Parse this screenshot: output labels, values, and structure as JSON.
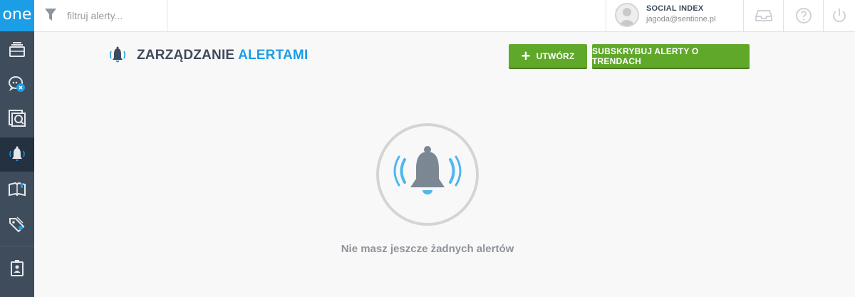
{
  "app": {
    "logo": "one"
  },
  "sidebar": {
    "items": [
      {
        "icon": "inbox-stack-icon"
      },
      {
        "icon": "chat-analysis-icon"
      },
      {
        "icon": "search-results-icon"
      },
      {
        "icon": "bell-alert-icon",
        "active": true
      },
      {
        "icon": "book-icon"
      },
      {
        "icon": "tags-icon"
      },
      {
        "icon": "id-badge-icon"
      }
    ]
  },
  "topbar": {
    "filter_placeholder": "filtruj alerty...",
    "user": {
      "name": "SOCIAL INDEX",
      "email": "jagoda@sentione.pl"
    },
    "buttons": [
      "inbox-icon",
      "help-icon",
      "power-icon"
    ]
  },
  "page": {
    "title_main": "ZARZĄDZANIE",
    "title_accent": "ALERTAMI",
    "create_label": "UTWÓRZ",
    "subscribe_label": "SUBSKRYBUJ ALERTY O TRENDACH",
    "empty_message": "Nie masz jeszcze żadnych alertów"
  },
  "colors": {
    "accent": "#1b9ee6",
    "sidebar": "#3f4c5c",
    "sidebar_active": "#243140",
    "button_green": "#5fa82a",
    "title": "#3e4b5c"
  }
}
